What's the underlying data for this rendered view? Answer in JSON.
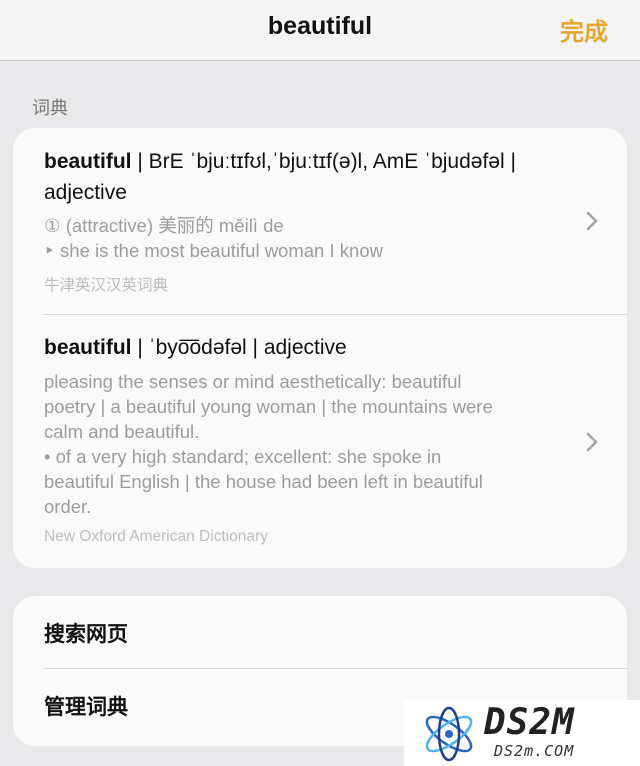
{
  "navbar": {
    "title": "beautiful",
    "done_label": "完成"
  },
  "section_header": "词典",
  "entries": [
    {
      "headword": "beautiful",
      "rest": " | BrE ˈbjuːtɪfʊl,ˈbjuːtɪf(ə)l, AmE ˈbjudəfəl | adjective",
      "lines": [
        "① (attractive) 美丽的 měilì de",
        "‣ she is the most beautiful woman I know"
      ],
      "source": "牛津英汉汉英词典"
    },
    {
      "headword": "beautiful",
      "rest": " | ˈbyo͞odəfəl | adjective",
      "lines": [
        "pleasing the senses or mind aesthetically: beautiful",
        "poetry | a beautiful young woman | the mountains were",
        "calm and beautiful.",
        "• of a very high standard; excellent: she spoke in",
        "beautiful English | the house had been left in beautiful",
        "order."
      ],
      "source": "New Oxford American Dictionary"
    }
  ],
  "actions": {
    "search_web": "搜索网页",
    "manage_dictionaries": "管理词典"
  },
  "watermark": {
    "logo_text": "DS2M",
    "domain": "DS2m.COM"
  },
  "colors": {
    "accent": "#e4a72e",
    "background": "#e9e9ec",
    "card": "#fafafa",
    "secondary_text": "#9c9c9f"
  },
  "icons": {
    "chevron": "chevron-right-icon",
    "watermark": "atom-logo-icon"
  }
}
